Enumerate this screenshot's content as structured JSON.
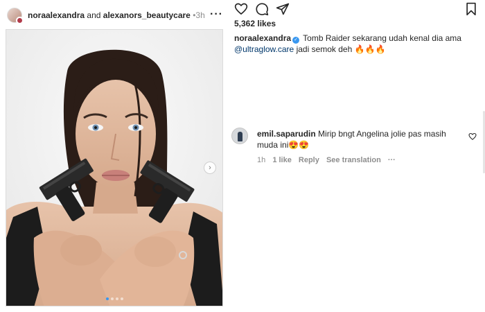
{
  "post": {
    "author": "noraalexandra",
    "connector": "and",
    "coauthor": "alexanors_beautycare",
    "separator": "•",
    "time": "3h",
    "more": "•••"
  },
  "photo": {
    "alt": "Woman posing with two pistols crossed over her chest",
    "next_glyph": "›",
    "carousel_count": 4,
    "carousel_active": 0
  },
  "actions": {
    "icons": [
      "heart-icon",
      "comment-icon",
      "share-icon",
      "bookmark-icon"
    ]
  },
  "likes": "5,362 likes",
  "caption": {
    "user": "noraalexandra",
    "text_1": " Tomb Raider sekarang udah kenal dia ama ",
    "mention": "@ultraglow.care",
    "text_2": " jadi semok deh 🔥🔥🔥"
  },
  "comment": {
    "user": "emil.saparudin",
    "text": " Mirip bngt Angelina jolie pas masih muda ini😍😍",
    "time": "1h",
    "likes": "1 like",
    "reply": "Reply",
    "translate": "See translation",
    "more": "•••"
  },
  "colors": {
    "accent": "#3897f0",
    "mention": "#00376b",
    "muted": "#8e8e8e"
  }
}
